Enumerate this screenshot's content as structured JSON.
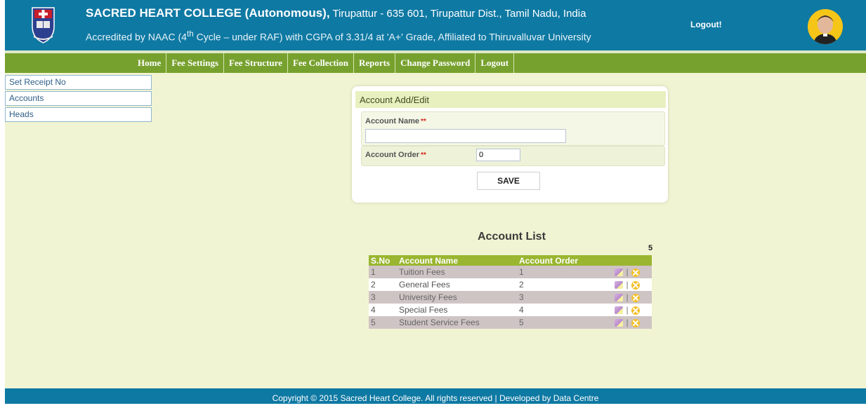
{
  "header": {
    "college_name": "SACRED HEART COLLEGE (Autonomous),",
    "address": " Tirupattur - 635 601, Tirupattur Dist., Tamil Nadu, India",
    "accreditation_prefix": "Accredited by NAAC (4",
    "accreditation_sup": "th",
    "accreditation_suffix": " Cycle – under RAF) with CGPA of 3.31/4 at 'A+' Grade, Affiliated to Thiruvalluvar University",
    "logout_label": "Logout!"
  },
  "nav": {
    "items": [
      "Home",
      "Fee Settings",
      "Fee Structure",
      "Fee Collection",
      "Reports",
      "Change Password",
      "Logout"
    ]
  },
  "sidebar": {
    "items": [
      "Set Receipt No",
      "Accounts",
      "Heads"
    ]
  },
  "form": {
    "title": "Account Add/Edit",
    "account_name_label": "Account Name",
    "account_name_value": "",
    "account_order_label": "Account Order",
    "account_order_value": "0",
    "required_mark": "**",
    "save_label": "SAVE"
  },
  "account_list": {
    "title": "Account List",
    "count": "5",
    "columns": [
      "S.No",
      "Account Name",
      "Account Order"
    ],
    "rows": [
      {
        "sno": "1",
        "name": "Tuition Fees",
        "order": "1"
      },
      {
        "sno": "2",
        "name": "General Fees",
        "order": "2"
      },
      {
        "sno": "3",
        "name": "University Fees",
        "order": "3"
      },
      {
        "sno": "4",
        "name": "Special Fees",
        "order": "4"
      },
      {
        "sno": "5",
        "name": "Student Service Fees",
        "order": "5"
      }
    ],
    "separator": "|"
  },
  "footer": {
    "text": "Copyright © 2015 Sacred Heart College. All rights reserved  |  Developed by Data Centre"
  },
  "colors": {
    "header_bg": "#0e79a3",
    "nav_bg": "#77a12e",
    "page_bg": "#f1f4d2",
    "table_header": "#9ab631"
  }
}
